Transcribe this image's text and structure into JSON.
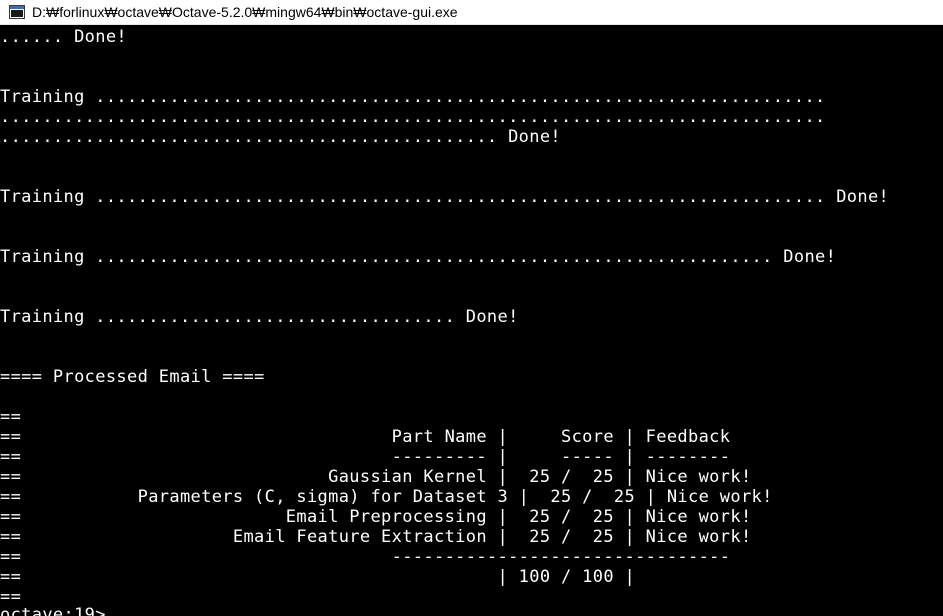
{
  "window": {
    "title": "D:₩forlinux₩octave₩Octave-5.2.0₩mingw64₩bin₩octave-gui.exe",
    "icon": "console-window-icon"
  },
  "console": {
    "lines": [
      "...... Done!",
      "",
      "",
      "Training .....................................................................",
      "..............................................................................",
      "............................................... Done!",
      "",
      "",
      "Training ..................................................................... Done!",
      "",
      "",
      "Training ................................................................ Done!",
      "",
      "",
      "Training .................................. Done!",
      "",
      "",
      "==== Processed Email ====",
      "",
      "==",
      "==                                   Part Name |     Score | Feedback",
      "==                                   --------- |     ----- | --------",
      "==                             Gaussian Kernel |  25 /  25 | Nice work!",
      "==           Parameters (C, sigma) for Dataset 3 |  25 /  25 | Nice work!",
      "==                         Email Preprocessing |  25 /  25 | Nice work!",
      "==                    Email Feature Extraction |  25 /  25 | Nice work!",
      "==                                   --------------------------------",
      "==                                             | 100 / 100 |",
      "==",
      "octave:19>"
    ]
  }
}
